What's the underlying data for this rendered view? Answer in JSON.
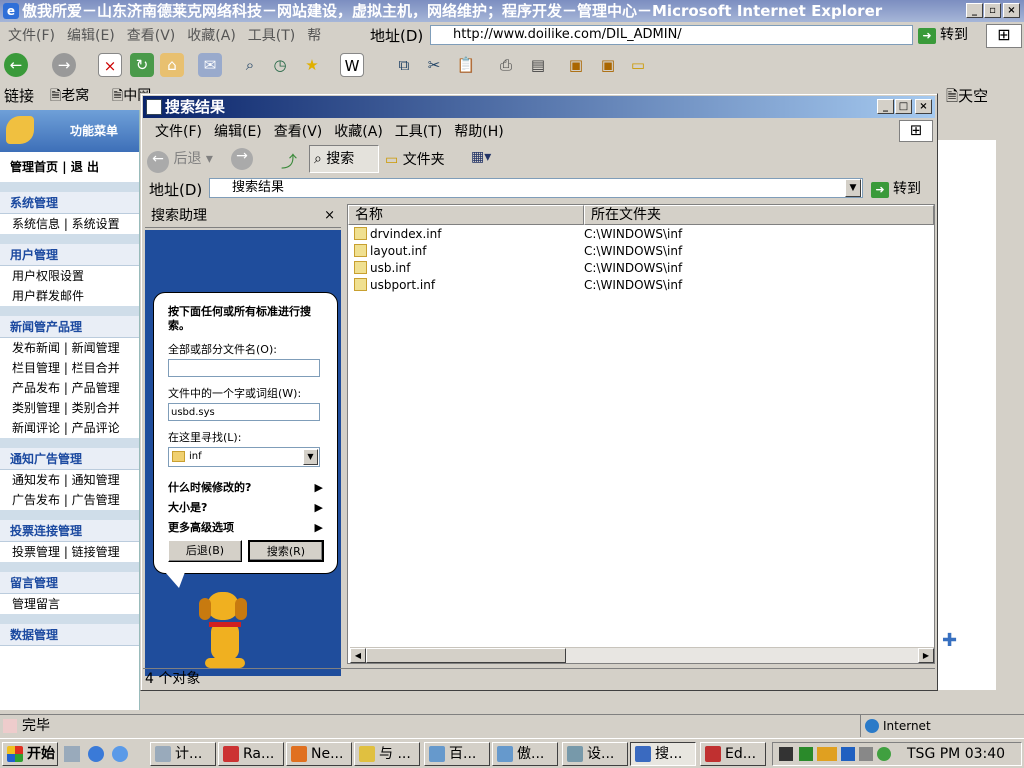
{
  "ie": {
    "title": "傲我所爱－山东济南德莱克网络科技－网站建设，虚拟主机，网络维护；程序开发－管理中心－Microsoft Internet Explorer",
    "menu": [
      "文件(F)",
      "编辑(E)",
      "查看(V)",
      "收藏(A)",
      "工具(T)",
      "帮"
    ],
    "address_label": "地址(D)",
    "address_value": "http://www.doilike.com/DIL_ADMIN/",
    "go_label": "转到",
    "links_label": "链接",
    "links": [
      "老窝",
      "中网"
    ],
    "links_right": "天空",
    "status_text": "完毕",
    "zone_text": "Internet"
  },
  "sidebar": {
    "title": "功能菜单",
    "top_links": [
      "管理首页",
      "退 出"
    ],
    "groups": [
      {
        "title": "系统管理",
        "items": [
          "系统信息 | 系统设置"
        ]
      },
      {
        "title": "用户管理",
        "items": [
          "用户权限设置",
          "用户群发邮件"
        ]
      },
      {
        "title": "新闻管产品理",
        "items": [
          "发布新闻 | 新闻管理",
          "栏目管理 | 栏目合并",
          "产品发布 | 产品管理",
          "类别管理 | 类别合并",
          "新闻评论 | 产品评论"
        ]
      },
      {
        "title": "通知广告管理",
        "items": [
          "通知发布 | 通知管理",
          "广告发布 | 广告管理"
        ]
      },
      {
        "title": "投票连接管理",
        "items": [
          "投票管理 | 链接管理"
        ]
      },
      {
        "title": "留言管理",
        "items": [
          "管理留言"
        ]
      },
      {
        "title": "数据管理",
        "items": []
      }
    ]
  },
  "search_window": {
    "title": "搜索结果",
    "menu": [
      "文件(F)",
      "编辑(E)",
      "查看(V)",
      "收藏(A)",
      "工具(T)",
      "帮助(H)"
    ],
    "toolbar": {
      "back": "后退",
      "search": "搜索",
      "folders": "文件夹"
    },
    "address_label": "地址(D)",
    "address_value": "搜索结果",
    "go_label": "转到",
    "pane_title": "搜索助理",
    "prompt": "按下面任何或所有标准进行搜索。",
    "filename_label": "全部或部分文件名(O):",
    "filename_value": "",
    "text_label": "文件中的一个字或词组(W):",
    "text_value": "usbd.sys",
    "lookin_label": "在这里寻找(L):",
    "lookin_value": "inf",
    "options": [
      "什么时候修改的?",
      "大小是?",
      "更多高级选项"
    ],
    "back_button": "后退(B)",
    "search_button": "搜索(R)",
    "columns": [
      "名称",
      "所在文件夹"
    ],
    "files": [
      {
        "name": "drvindex.inf",
        "folder": "C:\\WINDOWS\\inf"
      },
      {
        "name": "layout.inf",
        "folder": "C:\\WINDOWS\\inf"
      },
      {
        "name": "usb.inf",
        "folder": "C:\\WINDOWS\\inf"
      },
      {
        "name": "usbport.inf",
        "folder": "C:\\WINDOWS\\inf"
      }
    ],
    "status": "4 个对象"
  },
  "taskbar": {
    "start": "开始",
    "tasks": [
      "计...",
      "Ra...",
      "Ne...",
      "与 ...",
      "百...",
      "傲...",
      "设...",
      "搜...",
      "Ed..."
    ],
    "clock": "TSG PM 03:40"
  }
}
